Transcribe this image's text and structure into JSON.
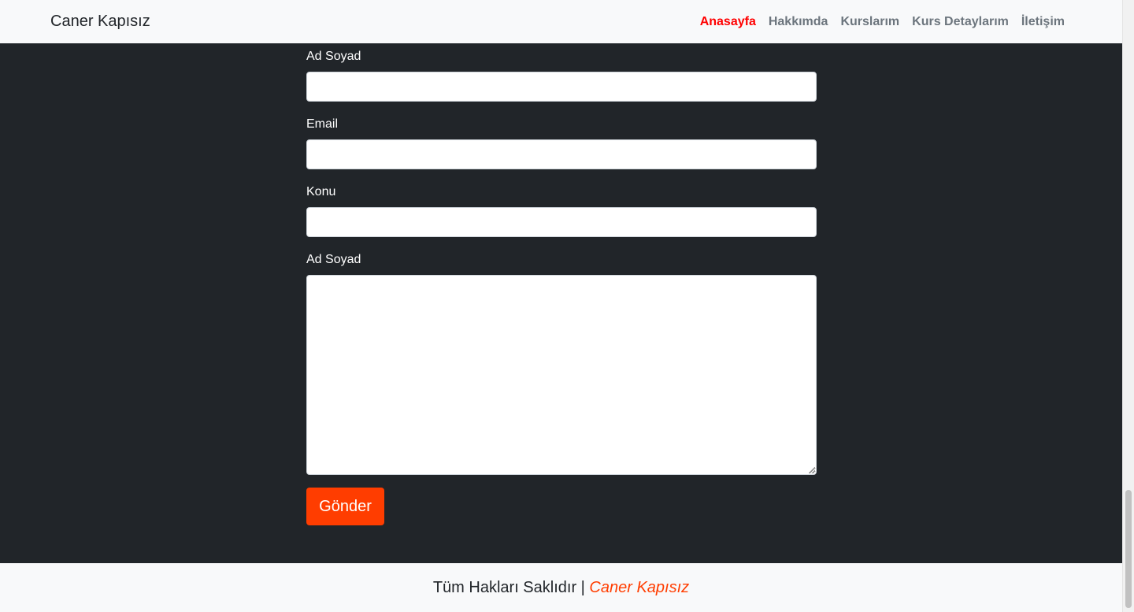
{
  "navbar": {
    "brand": "Caner Kapısız",
    "links": [
      {
        "label": "Anasayfa",
        "active": true
      },
      {
        "label": "Hakkımda",
        "active": false
      },
      {
        "label": "Kurslarım",
        "active": false
      },
      {
        "label": "Kurs Detaylarım",
        "active": false
      },
      {
        "label": "İletişim",
        "active": false
      }
    ]
  },
  "form": {
    "name_label": "Ad Soyad",
    "name_value": "",
    "email_label": "Email",
    "email_value": "",
    "subject_label": "Konu",
    "subject_value": "",
    "message_label": "Ad Soyad",
    "message_value": "",
    "submit_label": "Gönder"
  },
  "footer": {
    "text": "Tüm Hakları Saklıdır | ",
    "author": "Caner Kapısız"
  },
  "colors": {
    "accent": "#ff3d00",
    "active_link": "#ff0000",
    "dark_bg": "#212529",
    "light_bg": "#f8f9fa"
  }
}
